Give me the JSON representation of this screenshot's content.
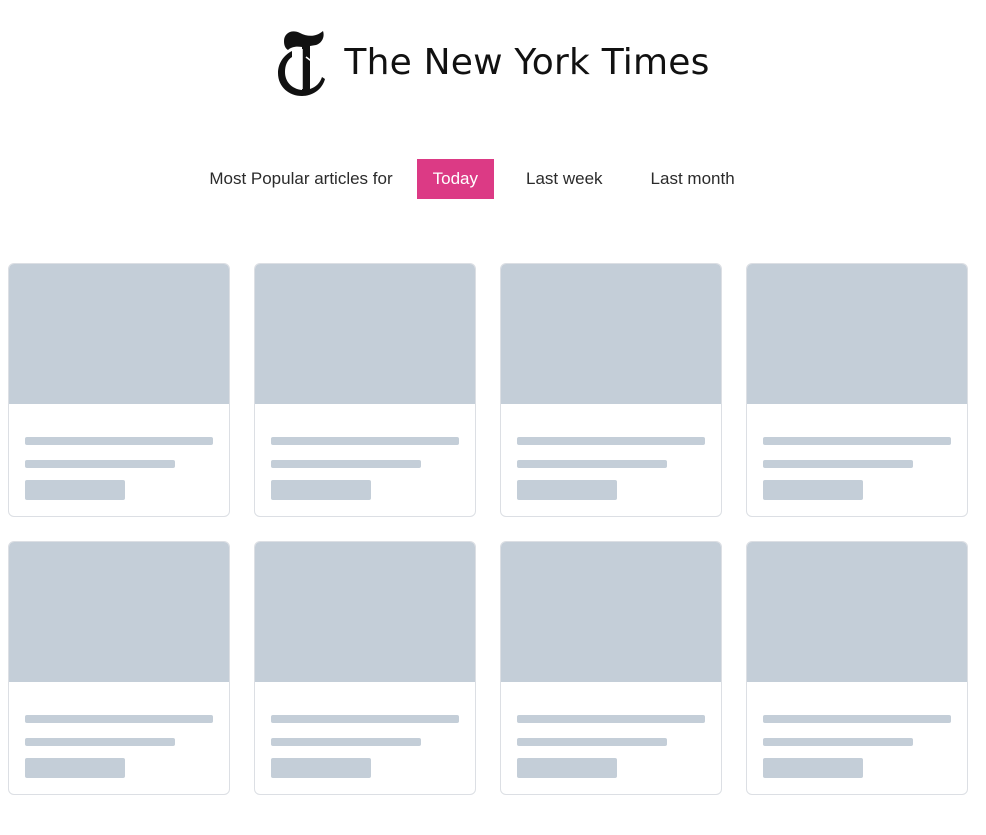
{
  "header": {
    "title": "The New York Times",
    "logo_icon": "nyt-t-logo-icon"
  },
  "filter": {
    "label": "Most Popular articles for",
    "options": [
      {
        "label": "Today",
        "active": true
      },
      {
        "label": "Last week",
        "active": false
      },
      {
        "label": "Last month",
        "active": false
      }
    ],
    "accent_color": "#dc3a85"
  },
  "articles": {
    "state": "loading-skeleton",
    "placeholder_color": "#c4ced8"
  }
}
